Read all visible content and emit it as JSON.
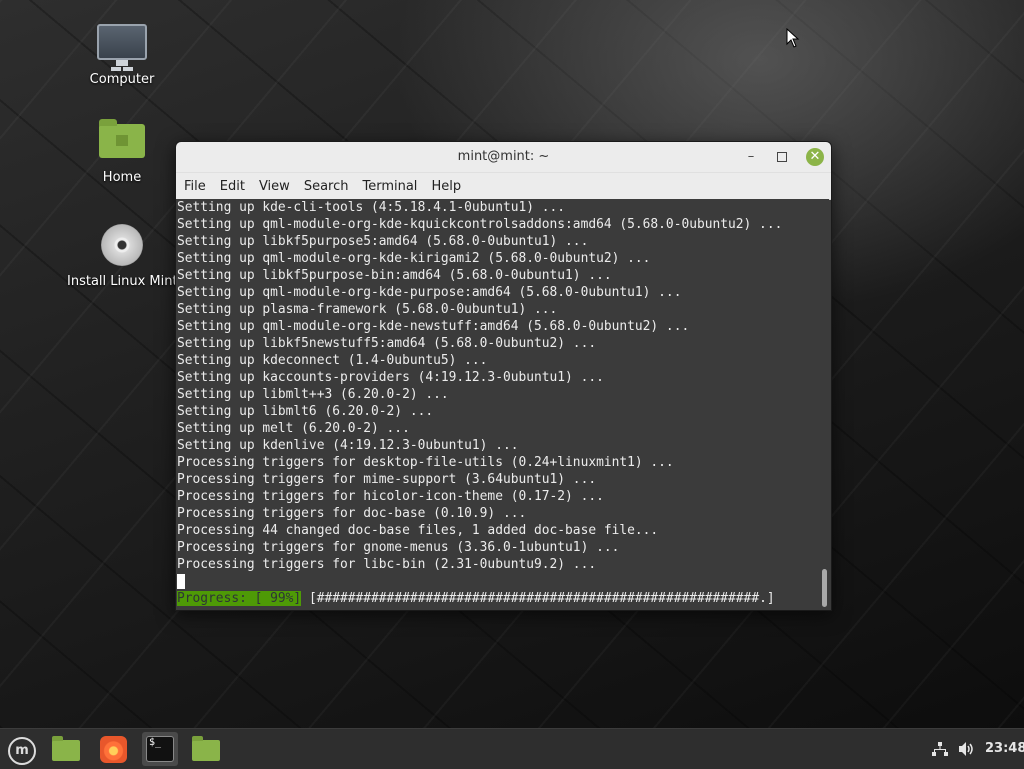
{
  "desktop": {
    "icons": [
      {
        "label": "Computer",
        "icon": "computer-icon"
      },
      {
        "label": "Home",
        "icon": "home-folder-icon"
      },
      {
        "label": "Install Linux Mint",
        "icon": "install-disc-icon"
      }
    ]
  },
  "window": {
    "title": "mint@mint: ~",
    "controls": {
      "minimize": "–",
      "close": "✕"
    },
    "menu": [
      "File",
      "Edit",
      "View",
      "Search",
      "Terminal",
      "Help"
    ]
  },
  "terminal": {
    "lines": [
      "Setting up kde-cli-tools (4:5.18.4.1-0ubuntu1) ...",
      "Setting up qml-module-org-kde-kquickcontrolsaddons:amd64 (5.68.0-0ubuntu2) ...",
      "Setting up libkf5purpose5:amd64 (5.68.0-0ubuntu1) ...",
      "Setting up qml-module-org-kde-kirigami2 (5.68.0-0ubuntu2) ...",
      "Setting up libkf5purpose-bin:amd64 (5.68.0-0ubuntu1) ...",
      "Setting up qml-module-org-kde-purpose:amd64 (5.68.0-0ubuntu1) ...",
      "Setting up plasma-framework (5.68.0-0ubuntu1) ...",
      "Setting up qml-module-org-kde-newstuff:amd64 (5.68.0-0ubuntu2) ...",
      "Setting up libkf5newstuff5:amd64 (5.68.0-0ubuntu2) ...",
      "Setting up kdeconnect (1.4-0ubuntu5) ...",
      "Setting up kaccounts-providers (4:19.12.3-0ubuntu1) ...",
      "Setting up libmlt++3 (6.20.0-2) ...",
      "Setting up libmlt6 (6.20.0-2) ...",
      "Setting up melt (6.20.0-2) ...",
      "Setting up kdenlive (4:19.12.3-0ubuntu1) ...",
      "Processing triggers for desktop-file-utils (0.24+linuxmint1) ...",
      "Processing triggers for mime-support (3.64ubuntu1) ...",
      "Processing triggers for hicolor-icon-theme (0.17-2) ...",
      "Processing triggers for doc-base (0.10.9) ...",
      "Processing 44 changed doc-base files, 1 added doc-base file...",
      "Processing triggers for gnome-menus (3.36.0-1ubuntu1) ...",
      "Processing triggers for libc-bin (2.31-0ubuntu9.2) ..."
    ],
    "progress_label": "Progress: [ 99%]",
    "progress_bar": " [#########################################################.]",
    "progress_percent": 99
  },
  "taskbar": {
    "items": [
      "menu-button",
      "files",
      "firefox",
      "terminal",
      "files"
    ],
    "clock": "23:48"
  }
}
